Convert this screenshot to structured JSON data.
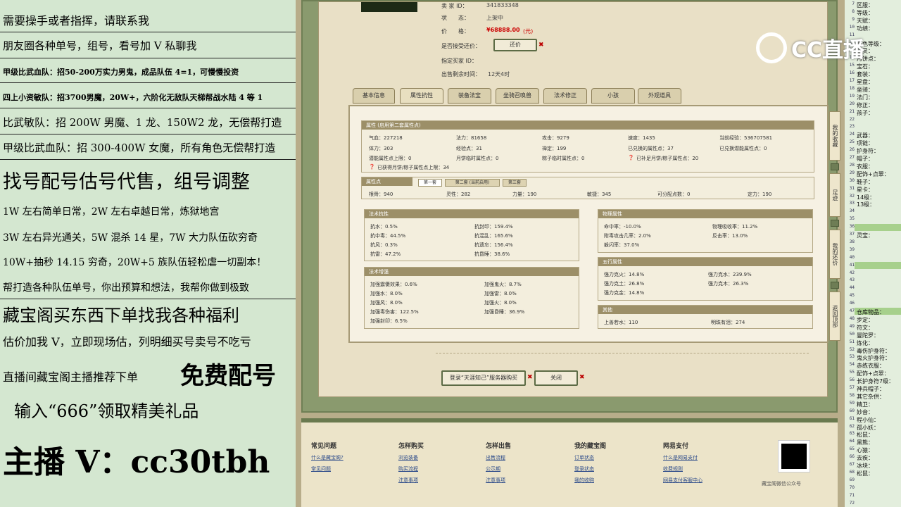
{
  "overlay": {
    "l1": "需要操手或者指挥，请联系我",
    "l2": "朋友圈各种单号，组号，看号加 V 私聊我",
    "l3": "甲级比武血队：招50-200万实力男鬼，成品队伍 4=1，可慢慢投资",
    "l4": "四上小资敏队：招3700男魔，20W+，六阶化无敌队天梯帮战水陆 4 等 1",
    "l5": "比武敏队：招 200W 男魔、1 龙、150W2 龙，无偿帮打造",
    "l6": "甲级比武血队：招 300-400W 女魔，所有角色无偿帮打造",
    "l7": "找号配号估号代售，组号调整",
    "l8": "1W 左右简单日常，2W 左右卓越日常，炼狱地宫",
    "l9": "3W 左右异光通关，5W 混杀 14 星，7W 大力队伍砍穷奇",
    "l10": "10W+抽秒 14.15 穷奇，20W+5 族队伍轻松虐一切副本！",
    "l11": "帮打造各种队伍单号，你出预算和想法，我帮你做到极致",
    "l12": "藏宝阁买东西下单找我各种福利",
    "l13": "估价加我 V，立即现场估，列明细买号卖号不吃亏",
    "l14a": "直播间藏宝阁主播推荐下单",
    "l14b": "免费配号",
    "l15": "输入“666”领取精美礼品",
    "l16": "主播 V：cc30tbh"
  },
  "info": {
    "seller_label": "卖 家 ID：",
    "seller_val": "341833348",
    "status_label": "状　　态：",
    "status_val": "上架中",
    "price_label": "价　　格：",
    "price_val": "¥68888.00",
    "price_unit": "(元)",
    "counter_label": "是否接受还价：",
    "counter_btn": "还价",
    "buyer_label": "指定买家 ID：",
    "remain_label": "出售剩余时间：",
    "remain_val": "12天4时"
  },
  "tabs": [
    "基本信息",
    "属性抗性",
    "装备法宝",
    "坐骑召唤兽",
    "法术修正",
    "小孩",
    "外观道具"
  ],
  "attr": {
    "title": "属性 (启用第二套属性点)",
    "r1": [
      "气血：227218",
      "法力：81658",
      "攻击：9279",
      "速度：1435",
      "当前经验：536707581"
    ],
    "r2": [
      "体力：303",
      "经验点：31",
      "禅定：199",
      "已兑换的属性点：37",
      "已兑换潜能属性点：0"
    ],
    "r3": [
      "潜能属性点上限：0",
      "月饼临时属性点：0",
      "粽子临时属性点：0",
      "已补足月饼/粽子属性点：20"
    ],
    "r4": "已获得月饼/粽子属性点上限：34"
  },
  "points": {
    "title": "属性点",
    "tabs": [
      "第一套",
      "第二套 (当前启用)",
      "第三套"
    ],
    "row": [
      "根骨：940",
      "灵性：282",
      "力量：190",
      "敏捷：345",
      "可分配点数：0",
      "定力：190"
    ]
  },
  "resist": {
    "title": "法术抗性",
    "items": [
      [
        "抗水：0.5%",
        "抗封印：159.4%"
      ],
      [
        "抗中毒：44.5%",
        "抗混乱：165.6%"
      ],
      [
        "抗风：0.3%",
        "抗遗忘：156.4%"
      ],
      [
        "抗雷：47.2%",
        "抗昏睡：38.6%"
      ]
    ]
  },
  "boost": {
    "title": "法术增强",
    "items": [
      [
        "加强震慑效果：0.6%",
        "加强鬼火：8.7%"
      ],
      [
        "加强水：8.0%",
        "加强雷：8.0%"
      ],
      [
        "加强风：8.0%",
        "加强火：8.0%"
      ],
      [
        "加强毒伤害：122.5%",
        "加强昏睡：36.9%"
      ],
      [
        "加强封印：6.5%",
        ""
      ]
    ]
  },
  "phys": {
    "title": "物理属性",
    "items": [
      [
        "命中率：-10.0%",
        "物理吸收率：11.2%"
      ],
      [
        "附毒攻击几率：2.0%",
        "反击率：13.0%"
      ],
      [
        "躲闪率：37.0%",
        ""
      ]
    ]
  },
  "five": {
    "title": "五行属性",
    "items": [
      [
        "强力克火：14.8%",
        "强力克水：239.9%"
      ],
      [
        "强力克土：26.8%",
        "强力克木：26.3%"
      ],
      [
        "强力克金：14.8%",
        ""
      ]
    ]
  },
  "other": {
    "title": "其他",
    "items": [
      "上善若水：110",
      "明珠有泪：274"
    ]
  },
  "actions": {
    "login": "登录“天涯知己”服务器购买",
    "close": "关闭"
  },
  "side": [
    "我的收藏",
    "足迹",
    "我的还价",
    "返回顶部"
  ],
  "footer": {
    "cols": [
      {
        "h": "常见问题",
        "links": [
          "什么是藏宝阁?",
          "常见问题"
        ]
      },
      {
        "h": "怎样购买",
        "links": [
          "浏览装备",
          "购买流程",
          "注意事项"
        ]
      },
      {
        "h": "怎样出售",
        "links": [
          "出售流程",
          "公示期",
          "注意事项"
        ]
      },
      {
        "h": "我的藏宝阁",
        "links": [
          "订单状态",
          "登录状态",
          "我的收购"
        ]
      },
      {
        "h": "网易支付",
        "links": [
          "什么是网易支付",
          "收费规则",
          "网易支付客服中心"
        ]
      }
    ],
    "qr_caption": "藏宝阁微信公众号"
  },
  "right": {
    "lines": [
      "7",
      "8",
      "9",
      "10",
      "11",
      "12",
      "13",
      "14",
      "15",
      "16",
      "17",
      "18",
      "19",
      "20",
      "21",
      "22",
      "23",
      "24",
      "25",
      "26",
      "27",
      "28",
      "29",
      "30",
      "31",
      "32",
      "33",
      "34",
      "35",
      "36",
      "37",
      "38",
      "39",
      "40",
      "41",
      "42",
      "43",
      "44",
      "45",
      "46",
      "47",
      "48",
      "49",
      "50",
      "51",
      "52",
      "53",
      "54",
      "55",
      "56",
      "57",
      "58",
      "59",
      "60",
      "61",
      "62",
      "63",
      "64",
      "65",
      "66",
      "67",
      "68",
      "69",
      "70",
      "71",
      "72"
    ],
    "items": [
      "区服：",
      "等级：",
      "天赋：",
      "功绩：",
      "",
      "角色等级：",
      "回灵：",
      "月饼点：",
      "宝石：",
      "套装：",
      "星盘：",
      "坐骑：",
      "法门：",
      "修正：",
      "孩子：",
      "",
      "",
      "武器：",
      "项链：",
      "护身符：",
      "帽子：",
      "衣服：",
      "配饰+点翠：",
      "鞋子：",
      "星卡：",
      "14级：",
      "13级：",
      "",
      "",
      "",
      "灵宝：",
      "",
      "",
      "",
      "",
      "",
      "",
      "",
      "",
      "",
      "仓库物品：",
      "步定：",
      "符文：",
      "曼陀罗：",
      "炼化：",
      "毒伤护身符：",
      "鬼火护身符：",
      "赤练衣服：",
      "配饰+点翠：",
      "长护身符7级：",
      "神兵帽子：",
      "其它杂供：",
      "精卫：",
      "妙音：",
      "程小仙：",
      "孤小妖：",
      "松鼠：",
      "黑熊：",
      "心猿：",
      "去疾：",
      "冰块：",
      "松鼠："
    ]
  },
  "logo": {
    "text": "CC直播"
  }
}
